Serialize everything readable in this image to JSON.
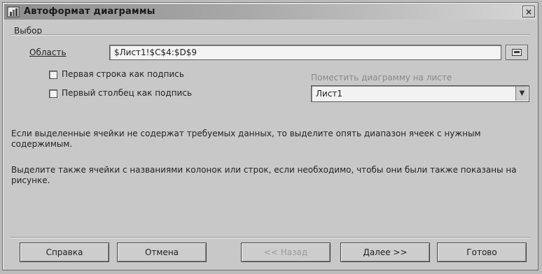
{
  "window": {
    "title": "Автоформат диаграммы",
    "close_glyph": "×"
  },
  "group": {
    "title": "Выбор"
  },
  "range": {
    "label": "Область",
    "value": "$Лист1!$C$4:$D$9"
  },
  "options": {
    "first_row": "Первая строка как подпись",
    "first_column": "Первый столбец как подпись"
  },
  "placement": {
    "label": "Поместить диаграмму на листе",
    "value": "Лист1"
  },
  "messages": {
    "line1": "Если выделенные ячейки не содержат требуемых данных, то выделите опять диапазон ячеек с нужным содержимым.",
    "line2": "Выделите также ячейки с названиями колонок или строк, если необходимо, чтобы они были также показаны на рисунке."
  },
  "buttons": {
    "help": "Справка",
    "cancel": "Отмена",
    "back": "<< Назад",
    "next": "Далее >>",
    "finish": "Готово"
  }
}
